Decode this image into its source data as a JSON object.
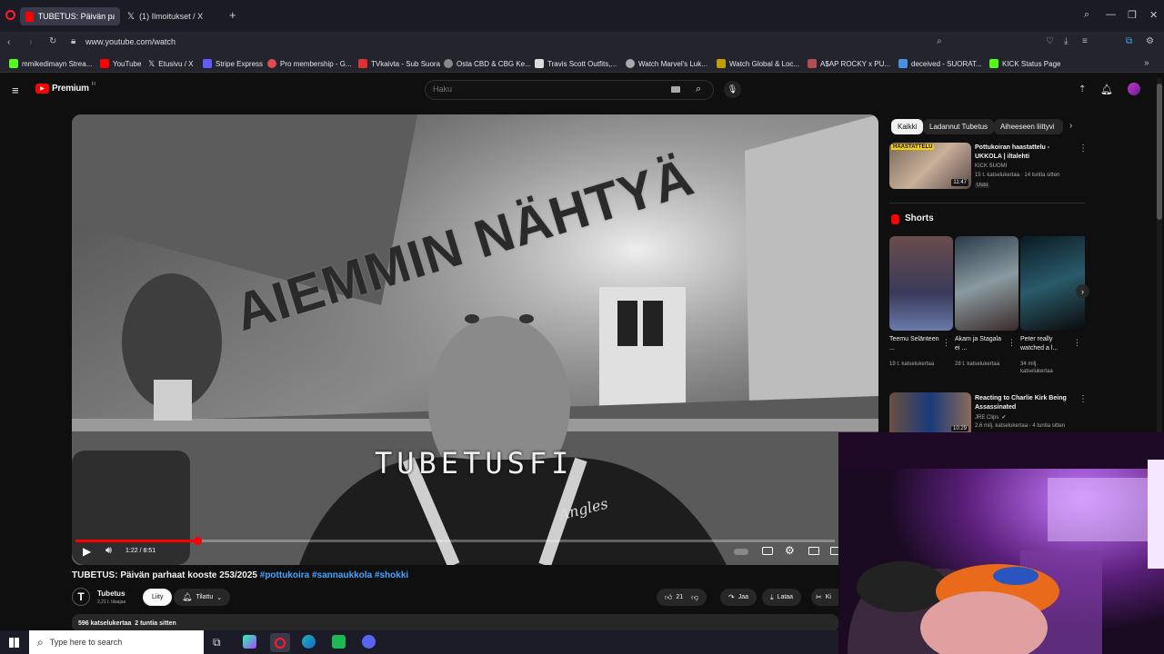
{
  "browser": {
    "tabs": [
      {
        "label": "TUBETUS: Päivän parhaat",
        "active": true
      },
      {
        "label": "(1) Ilmoitukset / X",
        "active": false
      }
    ],
    "url": "www.youtube.com/watch"
  },
  "bookmarks": [
    {
      "label": "mmikedimayn Strea...",
      "color": "#53fc18"
    },
    {
      "label": "YouTube",
      "color": "#ff0000"
    },
    {
      "label": "Etusivu / X",
      "color": "#ffffff"
    },
    {
      "label": "Stripe Express",
      "color": "#635bff"
    },
    {
      "label": "Pro membership - G...",
      "color": "#e04b4b"
    },
    {
      "label": "TVkaivta - Sub Suora",
      "color": "#e03030"
    },
    {
      "label": "Osta CBD & CBG Ke...",
      "color": "#888888"
    },
    {
      "label": "Travis Scott Outfits,...",
      "color": "#dddddd"
    },
    {
      "label": "Watch Marvel's Luk...",
      "color": "#aaaaaa"
    },
    {
      "label": "Watch Global & Loc...",
      "color": "#c0a000"
    },
    {
      "label": "A$AP ROCKY x PU...",
      "color": "#b05050"
    },
    {
      "label": "deceived - SUORAT...",
      "color": "#4a90e2"
    },
    {
      "label": "KICK Status Page",
      "color": "#53fc18"
    }
  ],
  "youtube": {
    "logo_text": "Premium",
    "logo_badge": "FI",
    "search_placeholder": "Haku"
  },
  "player": {
    "overlay_top": "AIEMMIN NÄHTYÄ",
    "overlay_bottom": "TUBETUSFI",
    "shirt_text": "Angles",
    "time": "1:22 / 8:51",
    "progress": 0.16
  },
  "video": {
    "title_prefix": "TUBETUS: Päivän parhaat kooste 253/2025",
    "hashtags": "#pottukoira #sannaukkola #shokki",
    "channel": "Tubetus",
    "subscribers": "2,21 t. tilaajaa",
    "join_label": "Liity",
    "subscribed_label": "Tilattu",
    "likes": "21",
    "share_label": "Jaa",
    "download_label": "Lataa",
    "clip_label": "Ki",
    "views_date": "596 katselukertaa  2 tuntia sitten"
  },
  "sidebar": {
    "chips": [
      "Kaikki",
      "Ladannut Tubetus",
      "Aiheeseen liittyvi"
    ],
    "top_video": {
      "title": "Pottukoiran haastattelu - UKKOLA | iltalehti",
      "channel": "KICK SUOMI",
      "meta": "15 t. katselukertaa · 14 tuntia sitten",
      "badge": "Uusi",
      "duration": "11:47",
      "thumb_label": "HAASTATTELU"
    },
    "shorts_heading": "Shorts",
    "shorts": [
      {
        "title": "Teemu Selänteen ...",
        "views": "19 t. katselukertaa"
      },
      {
        "title": "Akam ja Stagala ei ...",
        "views": "28 t. katselukertaa"
      },
      {
        "title": "Peter really watched a l...",
        "views": "34 milj. katselukertaa"
      }
    ],
    "bottom_video": {
      "title": "Reacting to Charlie Kirk Being Assassinated",
      "channel": "JRE Clips",
      "meta": "2,6 milj. katselukertaa · 4 tuntia sitten",
      "duration": "10:29"
    }
  },
  "taskbar": {
    "search_placeholder": "Type here to search"
  }
}
